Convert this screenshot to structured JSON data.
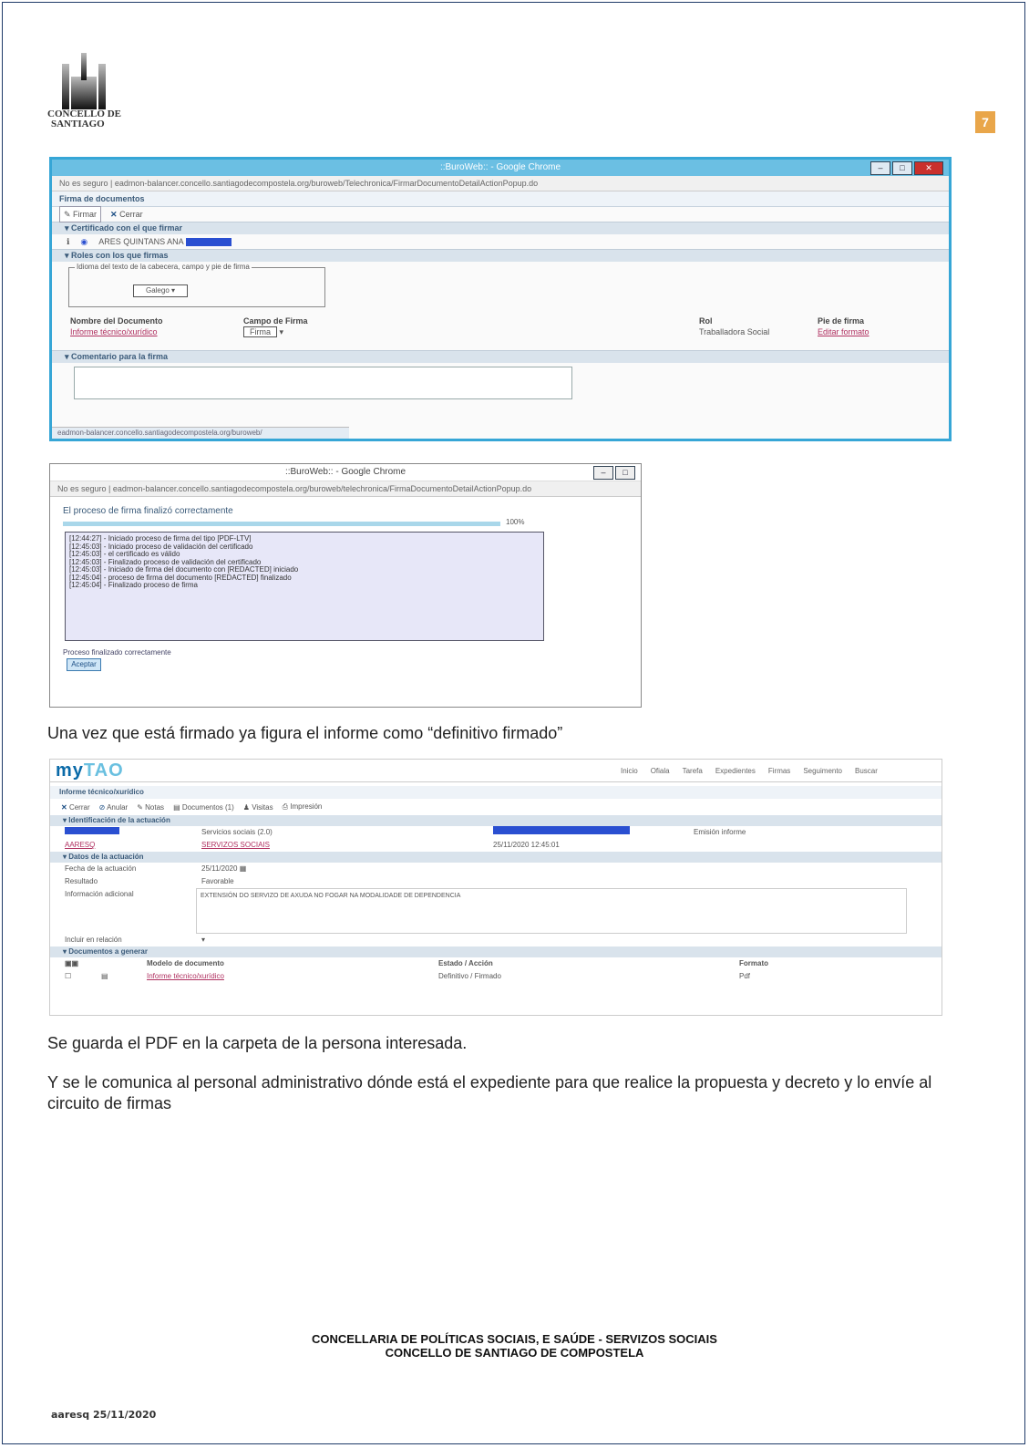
{
  "logo": {
    "line1": "CONCELLO DE",
    "line2": "SANTIAGO"
  },
  "page_number": "7",
  "shot1": {
    "window_title": "::BuroWeb:: - Google Chrome",
    "url": "No es seguro | eadmon-balancer.concello.santiagodecompostela.org/buroweb/Telechronica/FirmarDocumentoDetailActionPopup.do",
    "heading": "Firma de documentos",
    "sign_btn": "Firmar",
    "close_btn": "Cerrar",
    "sec_cert": "Certificado con el que firmar",
    "cert_name": "ARES QUINTANS ANA",
    "sec_roles": "Roles con los que firmas",
    "lang_legend": "Idioma del texto de la cabecera, campo y pie de firma",
    "lang_value": "Galego",
    "col_doc": "Nombre del Documento",
    "col_field": "Campo de Firma",
    "col_rol": "Rol",
    "col_foot": "Pie de firma",
    "doc_name": "Informe técnico/xurídico",
    "field_value": "Firma",
    "rol_value": "Traballadora Social",
    "foot_link": "Editar formato",
    "sec_comment": "Comentario para la firma",
    "status": "eadmon-balancer.concello.santiagodecompostela.org/buroweb/"
  },
  "shot2": {
    "window_title": "::BuroWeb:: - Google Chrome",
    "url": "No es seguro | eadmon-balancer.concello.santiagodecompostela.org/buroweb/telechronica/FirmaDocumentoDetailActionPopup.do",
    "message": "El proceso de firma finalizó correctamente",
    "pct": "100%",
    "log": [
      "[12:44:27] - Iniciado proceso de firma del tipo [PDF-LTV]",
      "[12:45:03] - Iniciado proceso de validación del certificado",
      "[12:45:03] - el certificado es válido",
      "[12:45:03] - Finalizado proceso de validación del certificado",
      "[12:45:03] - Iniciado de firma del documento con [REDACTED] iniciado",
      "[12:45:04] - proceso de firma del documento [REDACTED] finalizado",
      "[12:45:04] - Finalizado proceso de firma"
    ],
    "ok": "Proceso finalizado correctamente",
    "accept": "Aceptar"
  },
  "para1": "Una vez que está firmado ya figura el informe como “definitivo firmado”",
  "shot3": {
    "logo_a": "my",
    "logo_b": "TAO",
    "menu": [
      "Inicio",
      "Ofiala",
      "Tarefa",
      "Expedientes",
      "Firmas",
      "Seguimento",
      "Buscar"
    ],
    "title": "Informe técnico/xurídico",
    "tools": [
      "Cerrar",
      "Anular",
      "Notas",
      "Documentos (1)",
      "Visitas",
      "Impresión"
    ],
    "band1": "Identificación de la actuación",
    "service": "Servicios sociais (2.0)",
    "action": "Emisión informe",
    "dept": "SERVIZOS SOCIAIS",
    "user": "AARESQ",
    "stamp": "25/11/2020 12:45:01",
    "band2": "Datos de la actuación",
    "label_date": "Fecha de la actuación",
    "date_val": "25/11/2020",
    "label_result": "Resultado",
    "result_val": "Favorable",
    "label_info": "Información adicional",
    "info_val": "EXTENSIÓN DO SERVIZO DE AXUDA NO FOGAR NA MODALIDADE DE DEPENDENCIA",
    "label_rel": "Incluir en relación",
    "band3": "Documentos a generar",
    "col_model": "Modelo de documento",
    "col_state": "Estado / Acción",
    "col_format": "Formato",
    "doc_model": "Informe técnico/xurídico",
    "doc_state": "Definitivo / Firmado",
    "doc_format": "Pdf"
  },
  "para2": "Se guarda el PDF en la carpeta de la persona interesada.",
  "para3": "Y se le comunica al personal administrativo dónde está el expediente para que realice la propuesta y decreto y lo envíe al circuito de firmas",
  "footer": {
    "line1": "CONCELLARIA DE POLÍTICAS SOCIAIS, E SAÚDE - SERVIZOS SOCIAIS",
    "line2": "CONCELLO DE SANTIAGO DE COMPOSTELA"
  },
  "date_line": "aaresq 25/11/2020",
  "colors": {
    "frame": "#1f3a68",
    "accent": "#36a6d6",
    "redaction": "#2a4fd1",
    "page_badge": "#e9a64a"
  }
}
